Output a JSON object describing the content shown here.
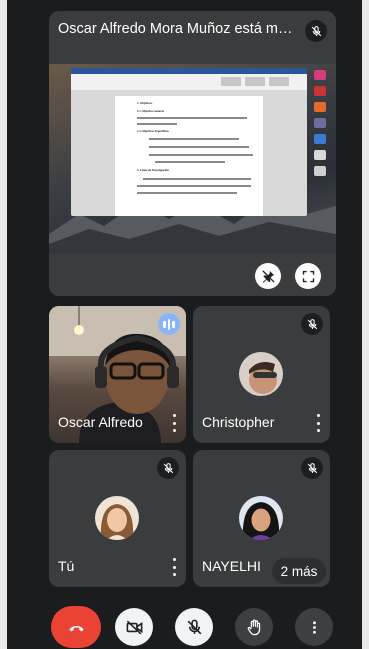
{
  "presentation": {
    "title": "Oscar Alfredo Mora Muñoz está mostr...",
    "document": {
      "heading_1": "2. Objetivos",
      "heading_2": "2.1 Objetivo General",
      "heading_3": "2.2 Objetivos Específicos",
      "heading_4": "3. Línea de Investigación"
    }
  },
  "participants": [
    {
      "name": "Oscar Alfredo",
      "speaking": true
    },
    {
      "name": "Christopher",
      "muted": true
    },
    {
      "name": "Tú",
      "muted": true
    },
    {
      "name": "NAYELHI",
      "muted": true
    }
  ],
  "more_chip": "2 más",
  "controls": {
    "end_call": "end-call-icon",
    "camera": "camera-off-icon",
    "mic": "mic-off-icon",
    "hand": "raise-hand-icon",
    "more": "more-vert-icon"
  },
  "colors": {
    "end_call": "#ea4335",
    "speaking": "#8ab4f8",
    "tile": "#3b3c3e",
    "background": "#1b1c1e"
  }
}
